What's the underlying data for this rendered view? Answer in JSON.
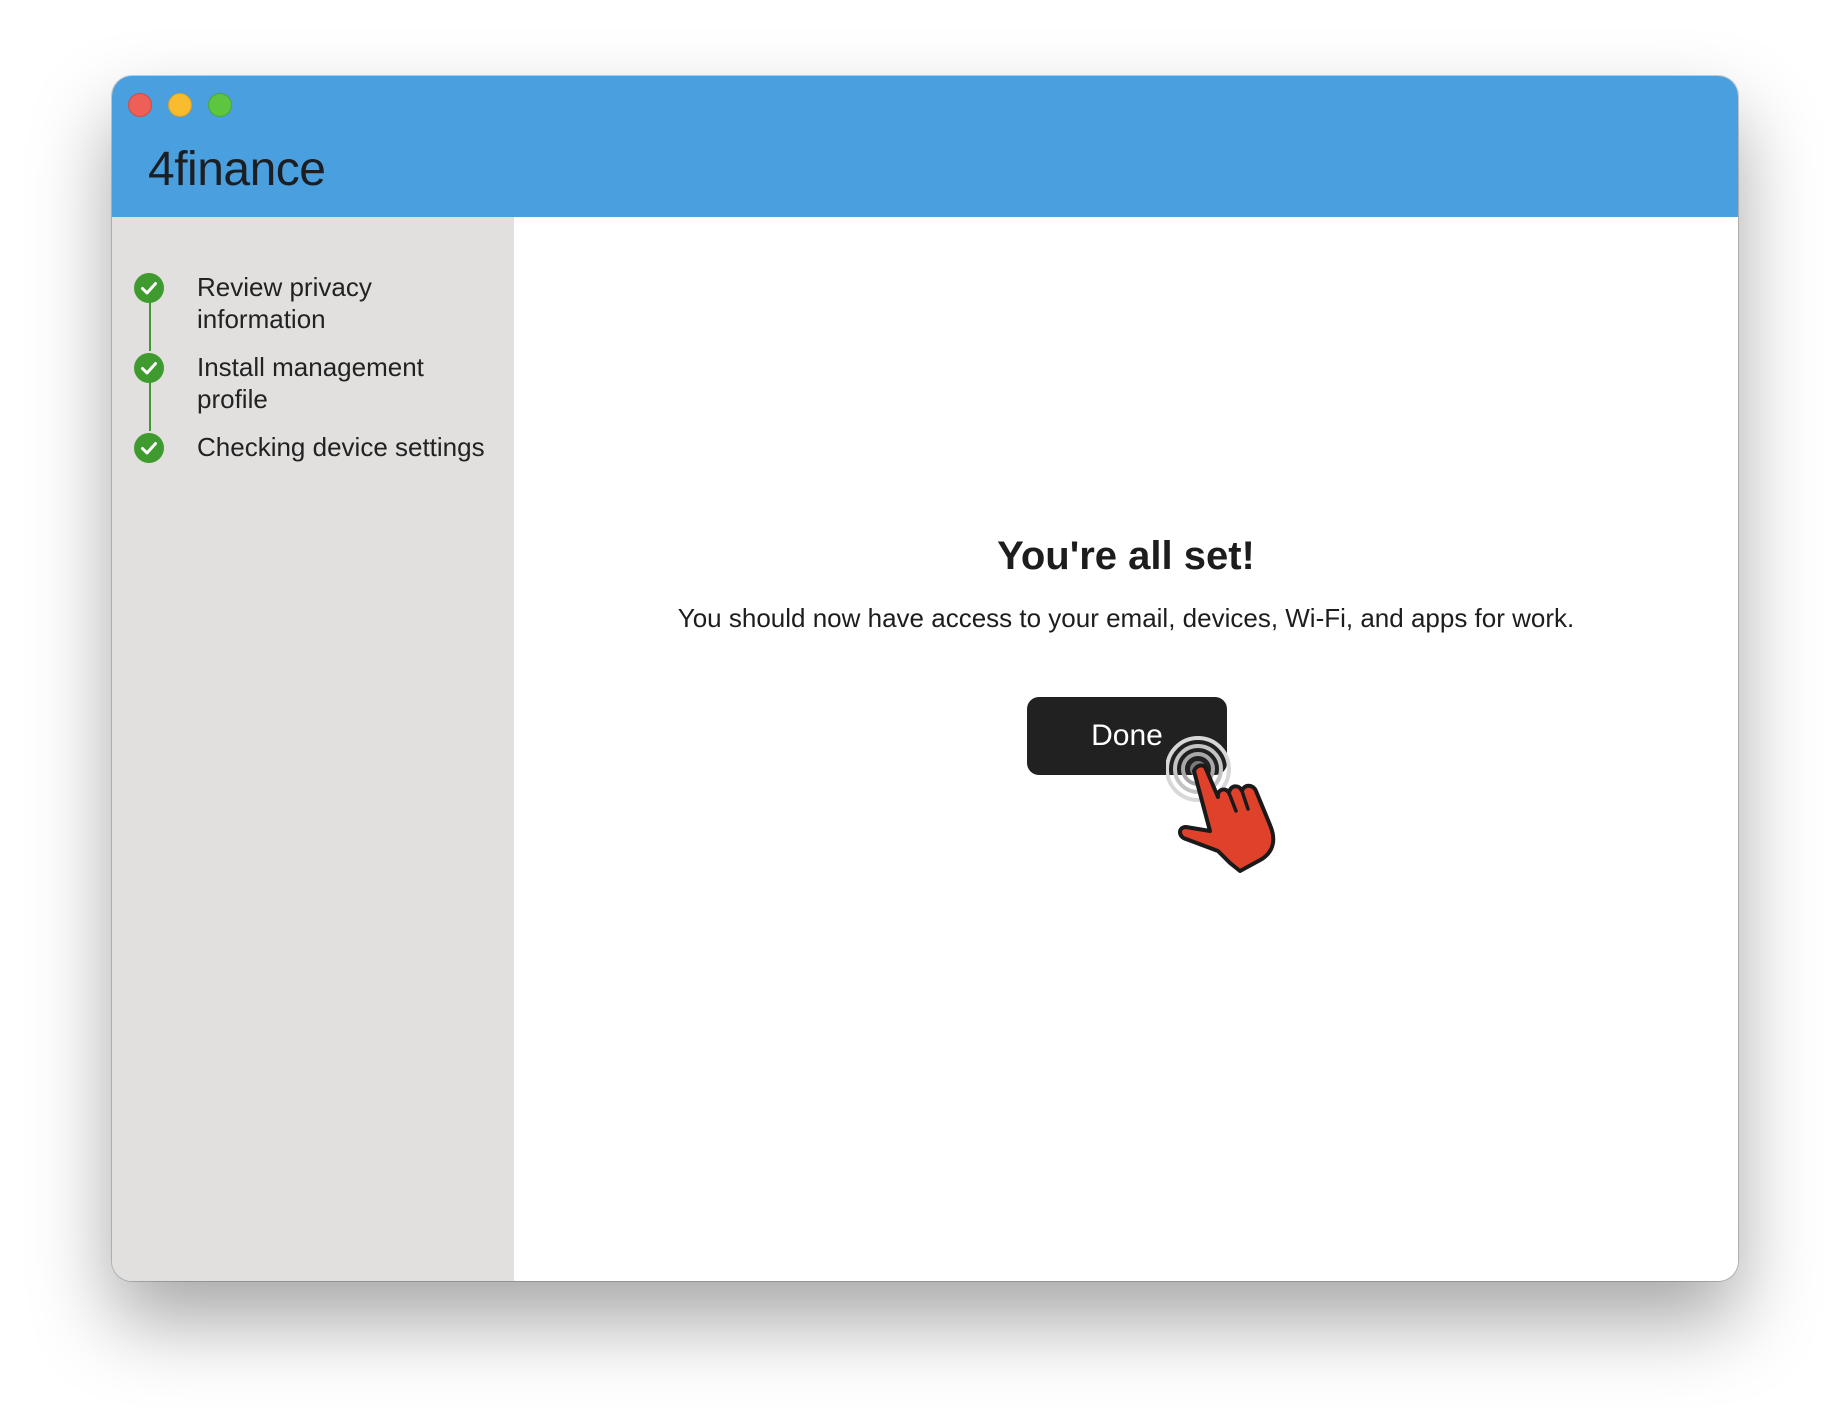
{
  "window": {
    "app_title": "4finance",
    "controls": [
      "close",
      "minimize",
      "zoom"
    ]
  },
  "sidebar": {
    "steps": [
      {
        "label": "Review privacy information",
        "status": "complete"
      },
      {
        "label": "Install management profile",
        "status": "complete"
      },
      {
        "label": "Checking device settings",
        "status": "complete"
      }
    ]
  },
  "main": {
    "headline": "You're all set!",
    "message": "You should now have access to your email, devices, Wi-Fi, and apps for work.",
    "done_label": "Done"
  },
  "colors": {
    "titlebar": "#4aa0de",
    "sidebar": "#e1e0df",
    "check": "#3f9b2f",
    "button": "#212121",
    "cursor_hand": "#e0412b"
  },
  "icons": {
    "step_complete": "check-circle-icon",
    "cursor": "pointing-hand-cursor-icon"
  }
}
